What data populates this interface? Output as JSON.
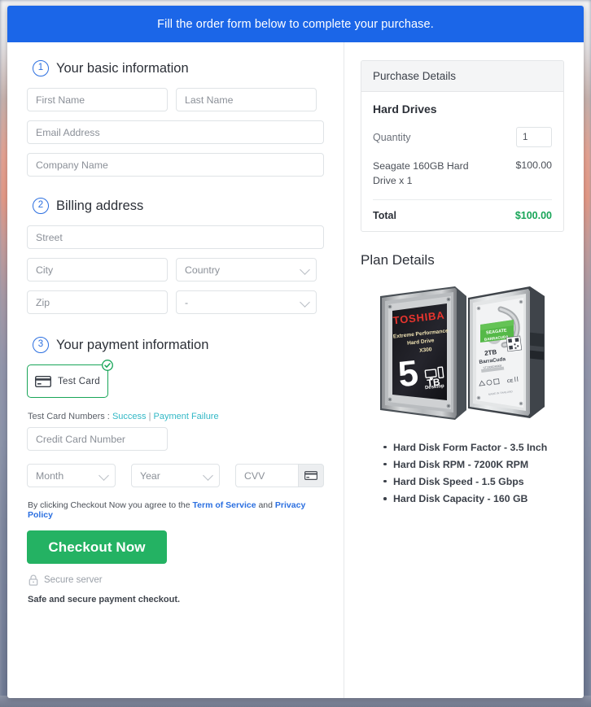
{
  "banner": {
    "message": "Fill the order form below to complete your purchase."
  },
  "colors": {
    "banner_blue": "#1b66e8",
    "step_blue": "#2b6fe0",
    "success_green": "#18a558",
    "checkout_green": "#24b263",
    "link_teal": "#32b8c6"
  },
  "steps": [
    {
      "number": "1",
      "title": "Your basic information"
    },
    {
      "number": "2",
      "title": "Billing address"
    },
    {
      "number": "3",
      "title": "Your payment information"
    }
  ],
  "basic_information": {
    "first_name": {
      "placeholder": "First Name",
      "value": ""
    },
    "last_name": {
      "placeholder": "Last Name",
      "value": ""
    },
    "email": {
      "placeholder": "Email Address",
      "value": ""
    },
    "company": {
      "placeholder": "Company Name",
      "value": ""
    }
  },
  "billing_address": {
    "street": {
      "placeholder": "Street",
      "value": ""
    },
    "city": {
      "placeholder": "City",
      "value": ""
    },
    "country": {
      "selected": "Country"
    },
    "zip": {
      "placeholder": "Zip",
      "value": ""
    },
    "state": {
      "selected": "-"
    }
  },
  "payment": {
    "method_label": "Test  Card",
    "method_selected": true,
    "test_cards_prefix": "Test Card Numbers :",
    "test_card_success": "Success",
    "test_card_separator": "|",
    "test_card_failure": "Payment Failure",
    "card_number": {
      "placeholder": "Credit Card Number",
      "value": ""
    },
    "month": {
      "selected": "Month"
    },
    "year": {
      "selected": "Year"
    },
    "cvv": {
      "placeholder": "CVV",
      "value": ""
    },
    "terms_prefix": "By clicking Checkout Now you agree to the",
    "terms_link": "Term of Service",
    "terms_and": "and",
    "privacy_link": "Privacy Policy",
    "checkout_label": "Checkout Now",
    "secure_server": "Secure server",
    "safe_note": "Safe and secure payment checkout."
  },
  "purchase_details": {
    "header": "Purchase Details",
    "product_name": "Hard Drives",
    "quantity_label": "Quantity",
    "quantity_value": "1",
    "line_item_description": "Seagate 160GB Hard Drive x 1",
    "line_item_amount": "$100.00",
    "total_label": "Total",
    "total_amount": "$100.00"
  },
  "plan_details": {
    "title": "Plan Details",
    "image_alt": "Two 3.5 inch desktop hard drives: a Toshiba X300 5TB Extreme Performance drive and a Seagate BarraCuda 2TB drive",
    "specs": [
      "Hard Disk Form Factor - 3.5 Inch",
      "Hard Disk RPM - 7200K RPM",
      "Hard Disk Speed - 1.5 Gbps",
      "Hard Disk Capacity - 160 GB"
    ]
  }
}
